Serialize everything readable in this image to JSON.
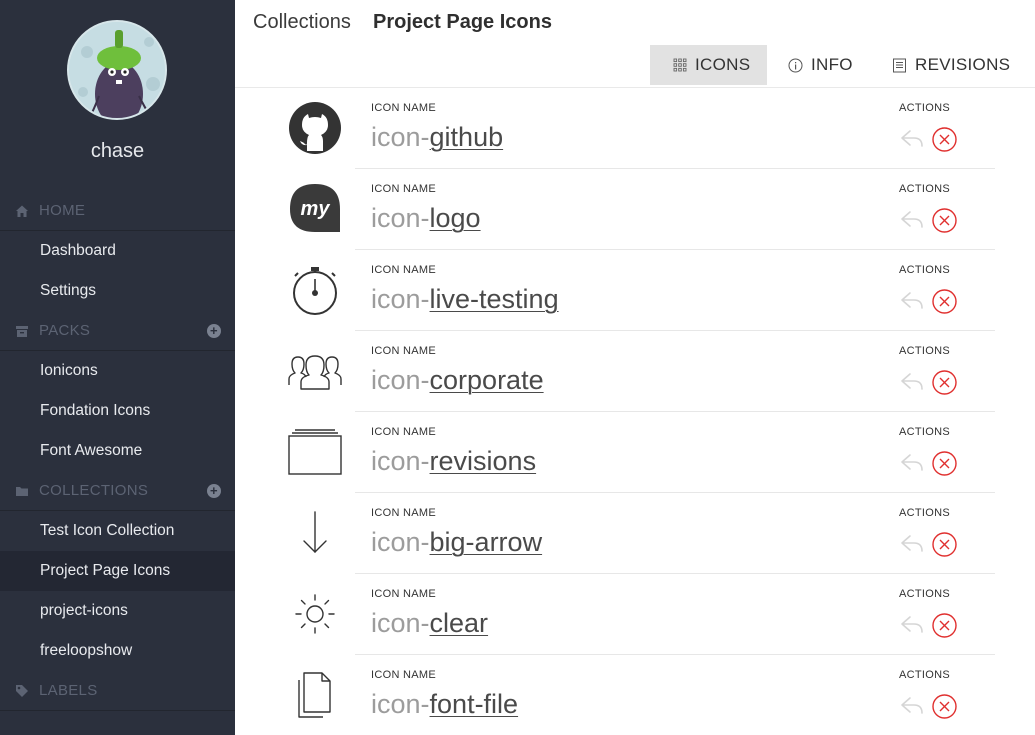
{
  "user": {
    "name": "chase"
  },
  "sidebar": {
    "home": {
      "label": "HOME",
      "items": [
        {
          "label": "Dashboard"
        },
        {
          "label": "Settings"
        }
      ]
    },
    "packs": {
      "label": "PACKS",
      "items": [
        {
          "label": "Ionicons"
        },
        {
          "label": "Fondation Icons"
        },
        {
          "label": "Font Awesome"
        }
      ]
    },
    "collections": {
      "label": "COLLECTIONS",
      "items": [
        {
          "label": "Test Icon Collection"
        },
        {
          "label": "Project Page Icons"
        },
        {
          "label": "project-icons"
        },
        {
          "label": "freeloopshow"
        }
      ]
    },
    "labels": {
      "label": "LABELS"
    }
  },
  "header": {
    "breadcrumb": "Collections",
    "title": "Project Page Icons",
    "tabs": [
      {
        "label": "ICONS"
      },
      {
        "label": "INFO"
      },
      {
        "label": "REVISIONS"
      }
    ]
  },
  "icons": [
    {
      "prefix": "icon-",
      "name": "github",
      "icon": "github-icon",
      "name_label": "ICON NAME",
      "actions_label": "ACTIONS"
    },
    {
      "prefix": "icon-",
      "name": "logo",
      "icon": "logo-icon",
      "logo_text": "my",
      "name_label": "ICON NAME",
      "actions_label": "ACTIONS"
    },
    {
      "prefix": "icon-",
      "name": "live-testing",
      "icon": "stopwatch-icon",
      "name_label": "ICON NAME",
      "actions_label": "ACTIONS"
    },
    {
      "prefix": "icon-",
      "name": "corporate",
      "icon": "people-group-icon",
      "name_label": "ICON NAME",
      "actions_label": "ACTIONS"
    },
    {
      "prefix": "icon-",
      "name": "revisions",
      "icon": "stacked-layers-icon",
      "name_label": "ICON NAME",
      "actions_label": "ACTIONS"
    },
    {
      "prefix": "icon-",
      "name": "big-arrow",
      "icon": "arrow-down-icon",
      "name_label": "ICON NAME",
      "actions_label": "ACTIONS"
    },
    {
      "prefix": "icon-",
      "name": "clear",
      "icon": "sun-icon",
      "name_label": "ICON NAME",
      "actions_label": "ACTIONS"
    },
    {
      "prefix": "icon-",
      "name": "font-file",
      "icon": "document-files-icon",
      "name_label": "ICON NAME",
      "actions_label": "ACTIONS"
    }
  ],
  "colors": {
    "sidebar_bg": "#2b303d",
    "active_bg": "#232733",
    "delete": "#e0302f",
    "tab_active": "#e2e2e2"
  }
}
